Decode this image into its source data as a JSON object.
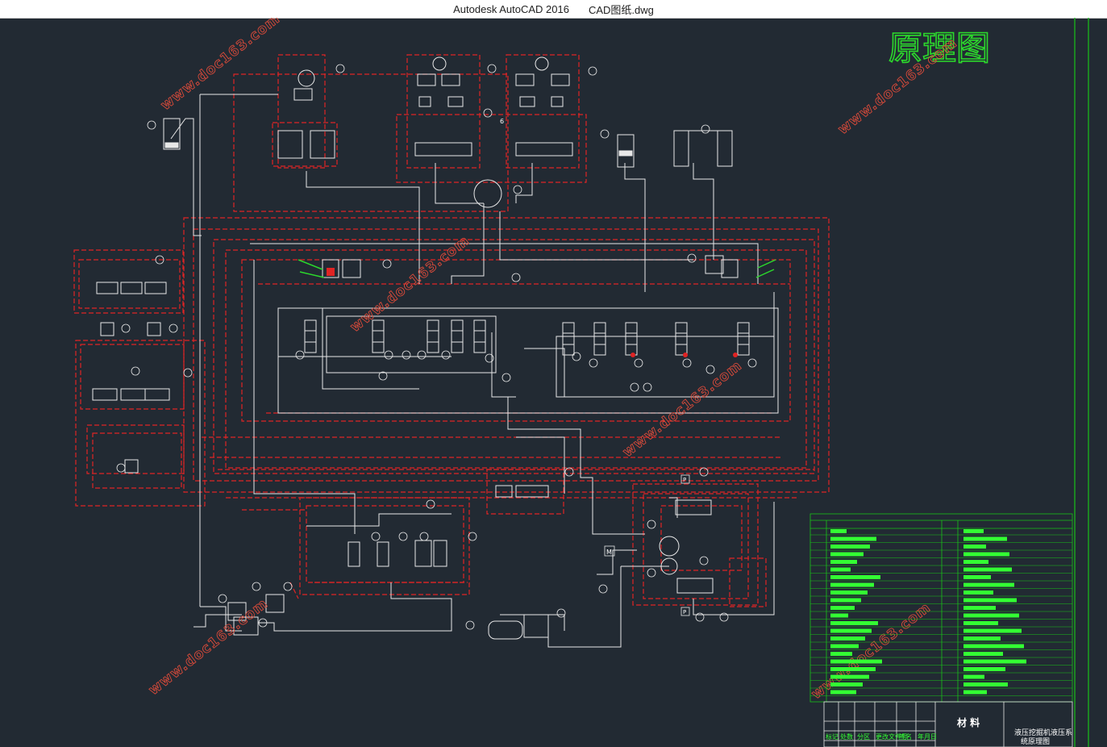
{
  "window": {
    "app_name": "Autodesk AutoCAD 2016",
    "file_name": "CAD图纸.dwg"
  },
  "drawing": {
    "title": "原理图",
    "watermark": "www.doc163.com",
    "label_6": "6",
    "label_M": "M",
    "label_P": "P"
  },
  "title_block": {
    "material_label": "材 料",
    "drawing_name_line1": "液压挖掘机液压系",
    "drawing_name_line2": "统原理图",
    "header_cells": [
      "标记",
      "处数",
      "分区",
      "更改文件号",
      "签名",
      "年月日"
    ]
  },
  "colors": {
    "background": "#222a33",
    "pipe_white": "#e8e8e8",
    "pipe_red": "#e02424",
    "title_green": "#2cd92c",
    "frame_green": "#19c219",
    "watermark": "#d84a3a"
  }
}
